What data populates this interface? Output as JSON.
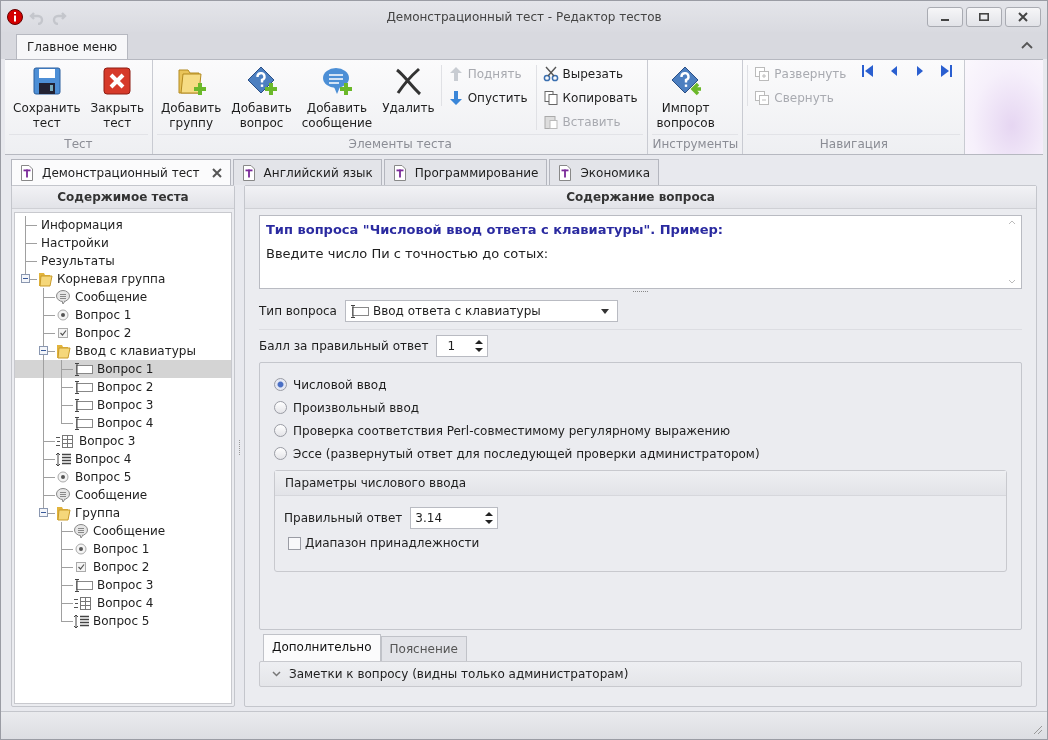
{
  "window": {
    "title": "Демонстрационный тест - Редактор тестов",
    "undo": {
      "disabled": true
    },
    "redo": {
      "disabled": true
    }
  },
  "ribbon": {
    "tabs": [
      {
        "label": "Главное меню",
        "selected": true
      }
    ],
    "groups": [
      {
        "label": "Тест",
        "items": [
          {
            "kind": "large",
            "label": "Сохранить тест",
            "disabled": false
          },
          {
            "kind": "large",
            "label": "Закрыть тест",
            "disabled": false
          }
        ]
      },
      {
        "label": "Элементы теста",
        "items": [
          {
            "kind": "large",
            "label": "Добавить группу",
            "disabled": false
          },
          {
            "kind": "large",
            "label": "Добавить вопрос",
            "disabled": false
          },
          {
            "kind": "large",
            "label": "Добавить сообщение",
            "disabled": false
          },
          {
            "kind": "large",
            "label": "Удалить",
            "disabled": false
          },
          {
            "kind": "stack",
            "buttons": [
              {
                "label": "Поднять",
                "disabled": true
              },
              {
                "label": "Опустить",
                "disabled": false
              }
            ]
          },
          {
            "kind": "stack",
            "buttons": [
              {
                "label": "Вырезать",
                "disabled": false
              },
              {
                "label": "Копировать",
                "disabled": false
              },
              {
                "label": "Вставить",
                "disabled": true
              }
            ]
          }
        ]
      },
      {
        "label": "Инструменты",
        "items": [
          {
            "kind": "large",
            "label": "Импорт вопросов",
            "disabled": false
          }
        ]
      },
      {
        "label": "Навигация",
        "items": [
          {
            "kind": "stack",
            "buttons": [
              {
                "label": "Развернуть",
                "disabled": true
              },
              {
                "label": "Свернуть",
                "disabled": true
              }
            ]
          },
          {
            "kind": "nav"
          }
        ]
      }
    ]
  },
  "doc_tabs": [
    {
      "label": "Демонстрационный тест",
      "selected": true
    },
    {
      "label": "Английский язык",
      "selected": false
    },
    {
      "label": "Программирование",
      "selected": false
    },
    {
      "label": "Экономика",
      "selected": false
    }
  ],
  "sidebar": {
    "header": "Содержимое теста",
    "tree": [
      {
        "label": "Информация",
        "kind": "page",
        "selected": false
      },
      {
        "label": "Настройки",
        "kind": "page",
        "selected": false
      },
      {
        "label": "Результаты",
        "kind": "page",
        "selected": false
      },
      {
        "label": "Корневая группа",
        "kind": "folder",
        "expanded": true,
        "selected": false,
        "children": [
          {
            "label": "Сообщение",
            "kind": "message",
            "selected": false
          },
          {
            "label": "Вопрос 1",
            "kind": "single",
            "selected": false
          },
          {
            "label": "Вопрос 2",
            "kind": "multiple",
            "selected": false
          },
          {
            "label": "Ввод с клавиатуры",
            "kind": "folder",
            "expanded": true,
            "selected": false,
            "children": [
              {
                "label": "Вопрос 1",
                "kind": "input",
                "selected": true
              },
              {
                "label": "Вопрос 2",
                "kind": "input",
                "selected": false
              },
              {
                "label": "Вопрос 3",
                "kind": "input",
                "selected": false
              },
              {
                "label": "Вопрос 4",
                "kind": "input",
                "selected": false
              }
            ]
          },
          {
            "label": "Вопрос 3",
            "kind": "matrix",
            "selected": false
          },
          {
            "label": "Вопрос 4",
            "kind": "order",
            "selected": false
          },
          {
            "label": "Вопрос 5",
            "kind": "single",
            "selected": false
          },
          {
            "label": "Сообщение",
            "kind": "message",
            "selected": false
          },
          {
            "label": "Группа",
            "kind": "folder",
            "expanded": true,
            "selected": false,
            "children": [
              {
                "label": "Сообщение",
                "kind": "message",
                "selected": false
              },
              {
                "label": "Вопрос 1",
                "kind": "single",
                "selected": false
              },
              {
                "label": "Вопрос 2",
                "kind": "multiple",
                "selected": false
              },
              {
                "label": "Вопрос 3",
                "kind": "input",
                "selected": false
              },
              {
                "label": "Вопрос 4",
                "kind": "matrix",
                "selected": false
              },
              {
                "label": "Вопрос 5",
                "kind": "order",
                "selected": false
              }
            ]
          }
        ]
      }
    ]
  },
  "question": {
    "header": "Содержание вопроса",
    "text": {
      "title": "Тип вопроса \"Числовой ввод ответа с клавиатуры\". Пример:",
      "body": "Введите число Пи с точностью до сотых:"
    },
    "type_field": {
      "label": "Тип вопроса",
      "value": "Ввод ответа с клавиатуры"
    },
    "score": {
      "label": "Балл за правильный ответ",
      "value": "1"
    },
    "modes": [
      {
        "label": "Числовой ввод",
        "selected": true
      },
      {
        "label": "Произвольный ввод",
        "selected": false
      },
      {
        "label": "Проверка соответствия Perl-совместимому регулярному выражению",
        "selected": false
      },
      {
        "label": "Эссе (развернутый ответ для последующей проверки администратором)",
        "selected": false
      }
    ],
    "params": {
      "title": "Параметры числового ввода",
      "answer": {
        "label": "Правильный ответ",
        "value": "3.14"
      },
      "range": {
        "label": "Диапазон принадлежности",
        "checked": false
      }
    },
    "bottom_tabs": [
      {
        "label": "Дополнительно",
        "selected": true
      },
      {
        "label": "Пояснение",
        "selected": false
      }
    ],
    "notes": {
      "label": "Заметки к вопросу (видны только администраторам)",
      "expanded": false
    }
  }
}
